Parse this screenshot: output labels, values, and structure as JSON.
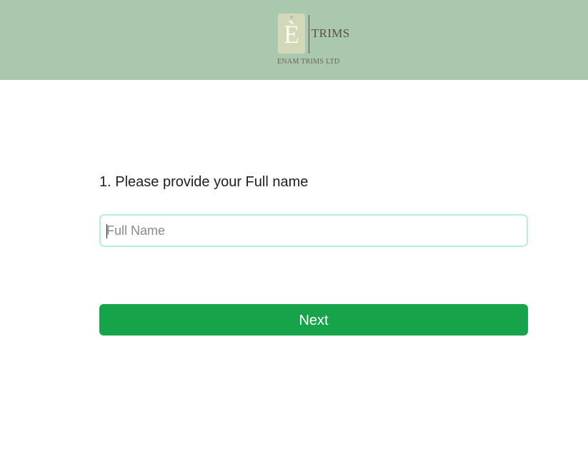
{
  "header": {
    "background_color": "#a9c8ae",
    "logo": {
      "letter": "È",
      "word": "TRIMS",
      "subtitle": "ENAM TRIMS LTD",
      "text_color": "#5b4d44",
      "tag_color": "#d3d8b8"
    }
  },
  "form": {
    "question": "1. Please provide your Full name",
    "name_field": {
      "placeholder": "Full Name",
      "value": "",
      "border_color": "#b5f0d2"
    },
    "next_button": {
      "label": "Next",
      "color": "#17a34a"
    }
  }
}
